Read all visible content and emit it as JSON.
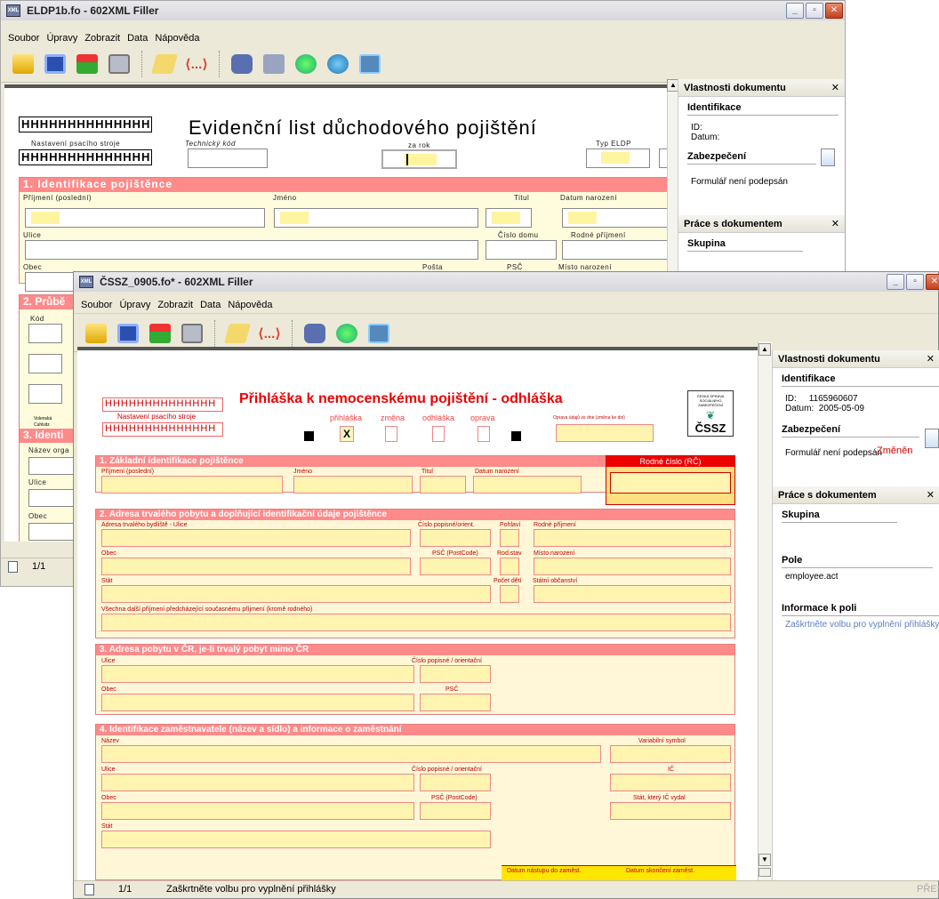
{
  "win1": {
    "title": "ELDP1b.fo - 602XML Filler",
    "menu": [
      "Soubor",
      "Úpravy",
      "Zobrazit",
      "Data",
      "Nápověda"
    ],
    "form": {
      "hbox1": "HHHHHHHHHHHHHH",
      "hbox2": "HHHHHHHHHHHHHH",
      "title": "Evidenční list důchodového pojištění",
      "sub_typewriter": "Nastavení psacího stroje",
      "sub_techcode": "Technický kód",
      "sub_year": "za rok",
      "sub_type": "Typ ELDP",
      "sec1": "1. Identifikace pojištěnce",
      "l_surname": "Příjmení (poslední)",
      "l_name": "Jméno",
      "l_title": "Titul",
      "l_dob": "Datum narození",
      "l_street": "Ulice",
      "l_housenum": "Číslo domu",
      "l_birthname": "Rodné příjmení",
      "l_city": "Obec",
      "l_post": "Pošta",
      "l_psc": "PSČ",
      "l_pob": "Místo narození",
      "sec2": "2. Průbě",
      "l_code": "Kód",
      "side_text": "Volenská\nCuhlsitz\nPPM/PP",
      "sec3": "3. Identi",
      "l_orgname": "Název orga",
      "l_street2": "Ulice",
      "l_city2": "Obec"
    },
    "panel": {
      "h1": "Vlastnosti dokumentu",
      "ident": "Identifikace",
      "id": "ID:",
      "date": "Datum:",
      "security": "Zabezpečení",
      "unsigned": "Formulář není podepsán",
      "h2": "Práce s dokumentem",
      "group": "Skupina"
    },
    "status": {
      "page": "1/1"
    }
  },
  "win2": {
    "title": "ČSSZ_0905.fo* - 602XML Filler",
    "menu": [
      "Soubor",
      "Úpravy",
      "Zobrazit",
      "Data",
      "Nápověda"
    ],
    "form": {
      "hbox1": "HHHHHHHHHHHHHH",
      "hbox2": "HHHHHHHHHHHHHH",
      "sub_typewriter": "Nastavení psacího stroje",
      "title": "Přihláška k nemocenskému pojištění - odhláška",
      "opts": [
        "přihláška",
        "změna",
        "odhláška",
        "oprava"
      ],
      "check_x": "X",
      "l_correction": "Oprava údajů ze dne (změna ke dni)",
      "logo": "ČSSZ",
      "logo_small": "ČESKÁ SPRÁVA SOCIÁLNÍHO ZABEZPEČENÍ",
      "sec1": "1. Základní identifikace pojištěnce",
      "rc": "Rodné číslo (RČ)",
      "s1_labels": [
        "Příjmení (poslední)",
        "Jméno",
        "Titul",
        "Datum narození"
      ],
      "sec2": "2. Adresa trvalého pobytu a doplňující identifikační údaje pojištěnce",
      "s2_l1": "Adresa trvalého bydliště - Ulice",
      "s2_l2": "Číslo popisné/orient.",
      "s2_l3": "Pohlaví",
      "s2_l4": "Rodné příjmení",
      "s2_l5": "Obec",
      "s2_l6": "PSČ (PostCode)",
      "s2_l7": "Rod.stav",
      "s2_l8": "Místo narození",
      "s2_l9": "Stát",
      "s2_l10": "Počet dětí",
      "s2_l11": "Státní občanství",
      "s2_l12": "Všechna další příjmení předcházející současnému příjmení (kromě rodného)",
      "sec3": "3. Adresa pobytu v ČR, je-li trvalý pobyt mimo ČR",
      "s3_l1": "Ulice",
      "s3_l2": "Číslo popisné / orientační",
      "s3_l3": "Obec",
      "s3_l4": "PSČ",
      "sec4": "4. Identifikace zaměstnavatele (název a sídlo) a informace o zaměstnání",
      "s4_l1": "Název",
      "s4_l2": "Variabilní symbol",
      "s4_l3": "Ulice",
      "s4_l4": "Číslo popisné / orientační",
      "s4_l5": "IČ",
      "s4_l6": "Obec",
      "s4_l7": "PSČ (PostCode)",
      "s4_l8": "Stát, který IČ vydal",
      "s4_l9": "Stát",
      "s4_b1": "Datum nástupu do zaměst.",
      "s4_b2": "Datum skončení zaměst."
    },
    "panel": {
      "h1": "Vlastnosti dokumentu",
      "ident": "Identifikace",
      "id_label": "ID:",
      "id": "1165960607",
      "date_label": "Datum:",
      "date": "2005-05-09",
      "security": "Zabezpečení",
      "changed": "Změněn",
      "unsigned": "Formulář není podepsán",
      "h2": "Práce s dokumentem",
      "group": "Skupina",
      "field": "Pole",
      "field_val": "employee.act",
      "finfo": "Informace k poli",
      "finfo_val": "Zaškrtněte volbu pro vyplnění přihlášky"
    },
    "status": {
      "page": "1/1",
      "msg": "Zaškrtněte volbu pro vyplnění přihlášky",
      "right": "PŘES"
    }
  }
}
